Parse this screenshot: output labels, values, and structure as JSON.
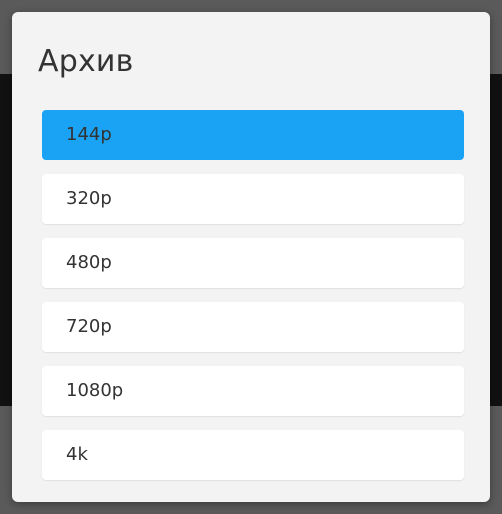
{
  "dialog": {
    "title": "Архив",
    "selected_index": 0,
    "options": [
      {
        "label": "144p"
      },
      {
        "label": "320p"
      },
      {
        "label": "480p"
      },
      {
        "label": "720p"
      },
      {
        "label": "1080p"
      },
      {
        "label": "4k"
      }
    ]
  },
  "colors": {
    "selected_option": "#1aa3f5",
    "option_background": "#ffffff",
    "dialog_background": "#f3f3f3",
    "text": "#333333"
  }
}
